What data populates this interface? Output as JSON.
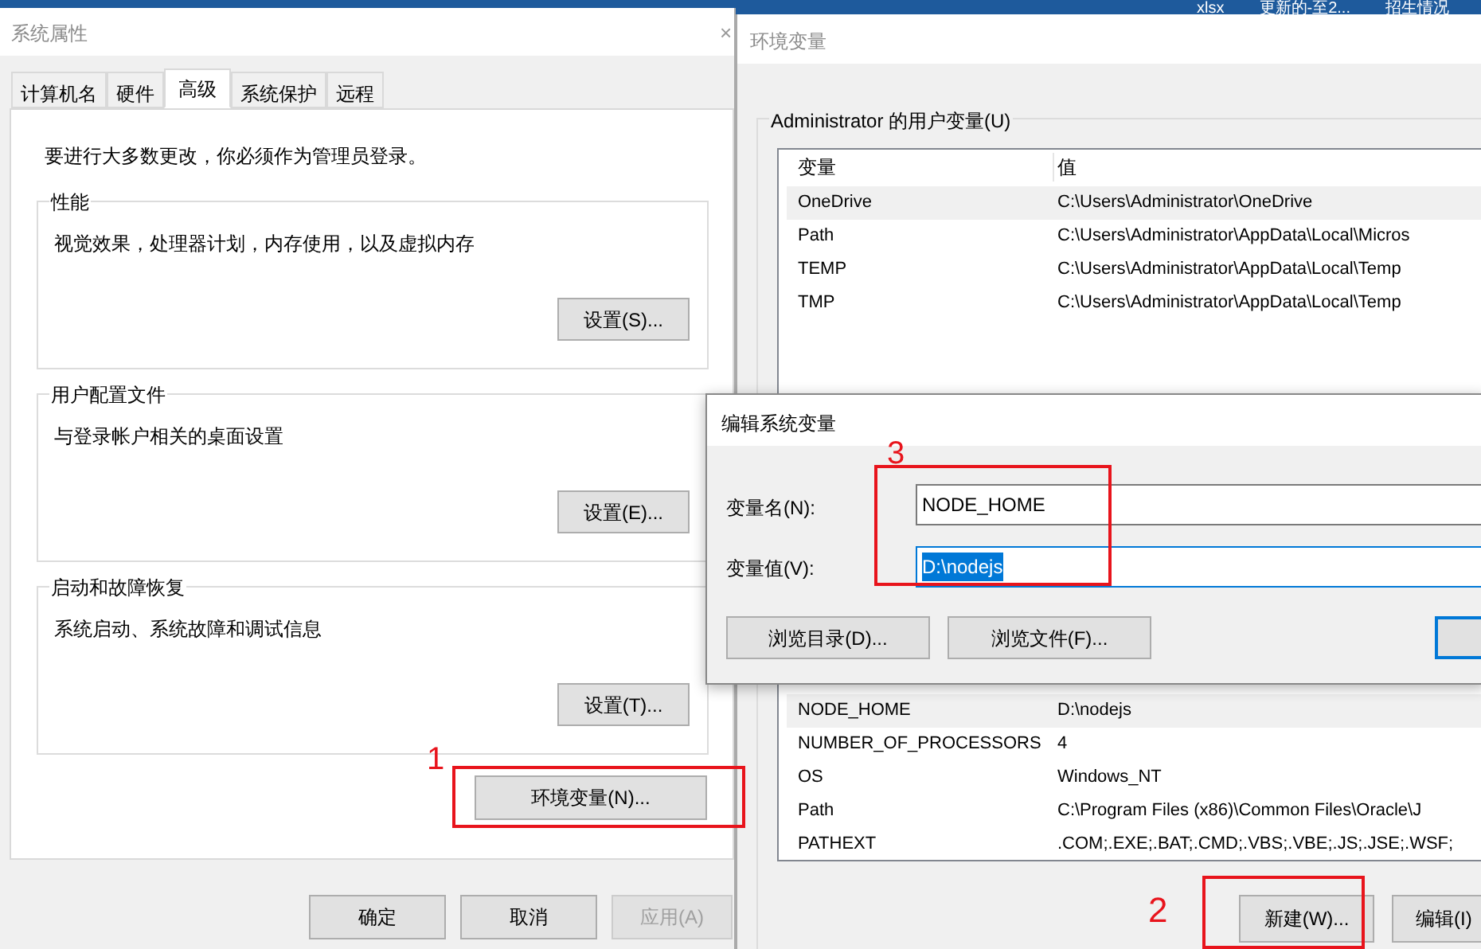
{
  "taskbar": {
    "items": [
      "xlsx",
      "更新的-至2...",
      "招生情况"
    ]
  },
  "system_properties": {
    "title": "系统属性",
    "close": "×",
    "tabs": [
      {
        "label": "计算机名",
        "selected": false
      },
      {
        "label": "硬件",
        "selected": false
      },
      {
        "label": "高级",
        "selected": true
      },
      {
        "label": "系统保护",
        "selected": false
      },
      {
        "label": "远程",
        "selected": false
      }
    ],
    "notice": "要进行大多数更改，你必须作为管理员登录。",
    "groups": [
      {
        "title": "性能",
        "text": "视觉效果，处理器计划，内存使用，以及虚拟内存",
        "button": "设置(S)..."
      },
      {
        "title": "用户配置文件",
        "text": "与登录帐户相关的桌面设置",
        "button": "设置(E)..."
      },
      {
        "title": "启动和故障恢复",
        "text": "系统启动、系统故障和调试信息",
        "button": "设置(T)..."
      }
    ],
    "env_button": "环境变量(N)...",
    "buttons": [
      {
        "label": "确定",
        "disabled": false
      },
      {
        "label": "取消",
        "disabled": false
      },
      {
        "label": "应用(A)",
        "disabled": true
      }
    ]
  },
  "environment_variables": {
    "title": "环境变量",
    "user_group": "Administrator 的用户变量(U)",
    "columns": [
      "变量",
      "值"
    ],
    "user_rows": [
      {
        "name": "OneDrive",
        "value": "C:\\Users\\Administrator\\OneDrive",
        "selected": true
      },
      {
        "name": "Path",
        "value": "C:\\Users\\Administrator\\AppData\\Local\\Micros",
        "selected": false
      },
      {
        "name": "TEMP",
        "value": "C:\\Users\\Administrator\\AppData\\Local\\Temp",
        "selected": false
      },
      {
        "name": "TMP",
        "value": "C:\\Users\\Administrator\\AppData\\Local\\Temp",
        "selected": false
      }
    ],
    "system_rows": [
      {
        "name": "NODE_HOME",
        "value": "D:\\nodejs",
        "selected": true
      },
      {
        "name": "NUMBER_OF_PROCESSORS",
        "value": "4",
        "selected": false
      },
      {
        "name": "OS",
        "value": "Windows_NT",
        "selected": false
      },
      {
        "name": "Path",
        "value": "C:\\Program Files (x86)\\Common Files\\Oracle\\J",
        "selected": false
      },
      {
        "name": "PATHEXT",
        "value": ".COM;.EXE;.BAT;.CMD;.VBS;.VBE;.JS;.JSE;.WSF;",
        "selected": false
      }
    ],
    "buttons": [
      "新建(W)...",
      "编辑(I)"
    ]
  },
  "edit_dialog": {
    "title": "编辑系统变量",
    "fields": [
      {
        "label": "变量名(N):",
        "value": "NODE_HOME",
        "selected": false
      },
      {
        "label": "变量值(V):",
        "value": "D:\\nodejs",
        "selected": true
      }
    ],
    "buttons": [
      "浏览目录(D)...",
      "浏览文件(F)..."
    ]
  },
  "annotations": [
    "1",
    "2",
    "3"
  ]
}
